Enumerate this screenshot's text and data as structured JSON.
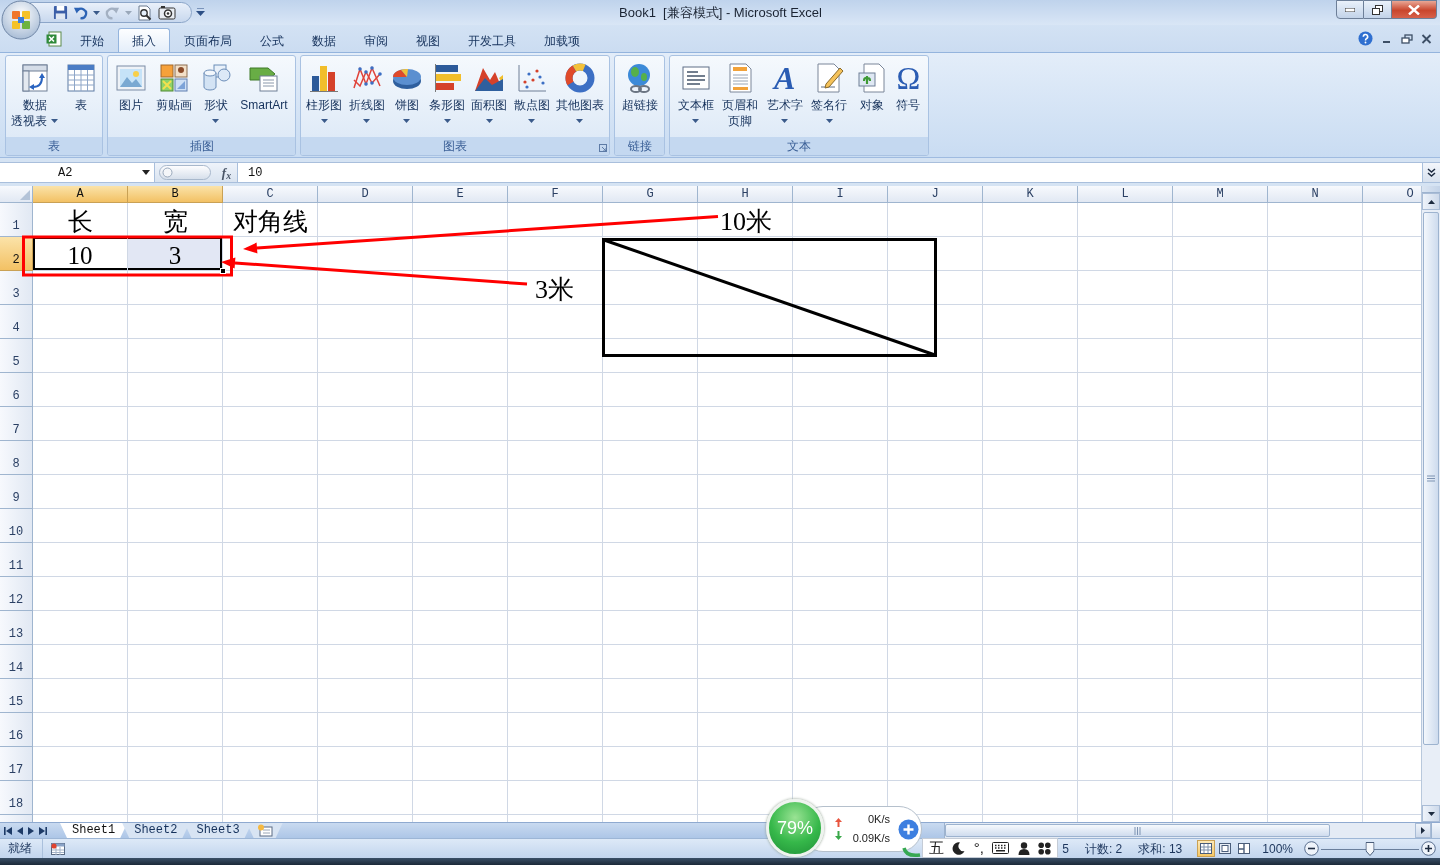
{
  "window": {
    "title": "Book1  [兼容模式] - Microsoft Excel"
  },
  "ribbon_tabs": [
    {
      "label": "开始",
      "selected": false
    },
    {
      "label": "插入",
      "selected": true
    },
    {
      "label": "页面布局",
      "selected": false
    },
    {
      "label": "公式",
      "selected": false
    },
    {
      "label": "数据",
      "selected": false
    },
    {
      "label": "审阅",
      "selected": false
    },
    {
      "label": "视图",
      "selected": false
    },
    {
      "label": "开发工具",
      "selected": false
    },
    {
      "label": "加载项",
      "selected": false
    }
  ],
  "ribbon_groups": [
    {
      "label": "表",
      "launcher": false,
      "commands": [
        {
          "lines": [
            "数据",
            "透视表"
          ],
          "dropdown": true
        },
        {
          "lines": [
            "表"
          ],
          "dropdown": false
        }
      ]
    },
    {
      "label": "插图",
      "launcher": false,
      "commands": [
        {
          "lines": [
            "图片"
          ],
          "dropdown": false
        },
        {
          "lines": [
            "剪贴画"
          ],
          "dropdown": false
        },
        {
          "lines": [
            "形状"
          ],
          "dropdown": true
        },
        {
          "lines": [
            "SmartArt"
          ],
          "dropdown": false
        }
      ]
    },
    {
      "label": "图表",
      "launcher": true,
      "commands": [
        {
          "lines": [
            "柱形图"
          ],
          "dropdown": true
        },
        {
          "lines": [
            "折线图"
          ],
          "dropdown": true
        },
        {
          "lines": [
            "饼图"
          ],
          "dropdown": true
        },
        {
          "lines": [
            "条形图"
          ],
          "dropdown": true
        },
        {
          "lines": [
            "面积图"
          ],
          "dropdown": true
        },
        {
          "lines": [
            "散点图"
          ],
          "dropdown": true
        },
        {
          "lines": [
            "其他图表"
          ],
          "dropdown": true
        }
      ]
    },
    {
      "label": "链接",
      "launcher": false,
      "commands": [
        {
          "lines": [
            "超链接"
          ],
          "dropdown": false
        }
      ]
    },
    {
      "label": "文本",
      "launcher": false,
      "commands": [
        {
          "lines": [
            "文本框"
          ],
          "dropdown": true
        },
        {
          "lines": [
            "页眉和",
            "页脚"
          ],
          "dropdown": false
        },
        {
          "lines": [
            "艺术字"
          ],
          "dropdown": true,
          "glyph": "A"
        },
        {
          "lines": [
            "签名行"
          ],
          "dropdown": true
        },
        {
          "lines": [
            "对象"
          ],
          "dropdown": false
        },
        {
          "lines": [
            "符号"
          ],
          "dropdown": false,
          "glyph": "Ω"
        }
      ]
    }
  ],
  "formula_bar": {
    "name_box": "A2",
    "fx": "f$_{x}$",
    "value": "10"
  },
  "sheet": {
    "columns": [
      {
        "label": "A",
        "selected": true
      },
      {
        "label": "B",
        "selected": true
      },
      {
        "label": "C",
        "selected": false
      },
      {
        "label": "D",
        "selected": false
      },
      {
        "label": "E",
        "selected": false
      },
      {
        "label": "F",
        "selected": false
      },
      {
        "label": "G",
        "selected": false
      },
      {
        "label": "H",
        "selected": false
      },
      {
        "label": "I",
        "selected": false
      },
      {
        "label": "J",
        "selected": false
      },
      {
        "label": "K",
        "selected": false
      },
      {
        "label": "L",
        "selected": false
      },
      {
        "label": "M",
        "selected": false
      },
      {
        "label": "N",
        "selected": false
      },
      {
        "label": "O",
        "selected": false
      }
    ],
    "rows": [
      {
        "label": "1",
        "selected": false,
        "cells": [
          {
            "value": "长",
            "selected": false,
            "active": false
          },
          {
            "value": "宽",
            "selected": false,
            "active": false
          },
          {
            "value": "对角线",
            "selected": false,
            "active": false
          }
        ]
      },
      {
        "label": "2",
        "selected": true,
        "cells": [
          {
            "value": "10",
            "selected": true,
            "active": true
          },
          {
            "value": "3",
            "selected": true,
            "active": false
          }
        ]
      },
      {
        "label": "3",
        "selected": false
      },
      {
        "label": "4",
        "selected": false
      },
      {
        "label": "5",
        "selected": false
      },
      {
        "label": "6",
        "selected": false
      },
      {
        "label": "7",
        "selected": false
      },
      {
        "label": "8",
        "selected": false
      },
      {
        "label": "9",
        "selected": false
      },
      {
        "label": "10",
        "selected": false
      },
      {
        "label": "11",
        "selected": false
      },
      {
        "label": "12",
        "selected": false
      },
      {
        "label": "13",
        "selected": false
      },
      {
        "label": "14",
        "selected": false
      },
      {
        "label": "15",
        "selected": false
      },
      {
        "label": "16",
        "selected": false
      },
      {
        "label": "17",
        "selected": false
      },
      {
        "label": "18",
        "selected": false
      }
    ],
    "callouts": [
      {
        "text": "10米"
      },
      {
        "text": "3米"
      }
    ]
  },
  "sheet_tabs": [
    {
      "label": "Sheet1",
      "selected": true
    },
    {
      "label": "Sheet2",
      "selected": false
    },
    {
      "label": "Sheet3",
      "selected": false
    }
  ],
  "status_bar": {
    "status": "就绪",
    "cut_text": "5",
    "count": "计数: 2",
    "sum": "求和: 13",
    "views": [
      {
        "selected": true
      },
      {
        "selected": false
      },
      {
        "selected": false
      }
    ],
    "zoom": "100%",
    "zoom_slider": {
      "level": 0.5
    }
  },
  "speed_widget": {
    "memory": "79%",
    "upload": "0K/s",
    "download": "0.09K/s"
  },
  "ime_toolbar": {
    "mode": "五",
    "punctuation": "°,"
  }
}
